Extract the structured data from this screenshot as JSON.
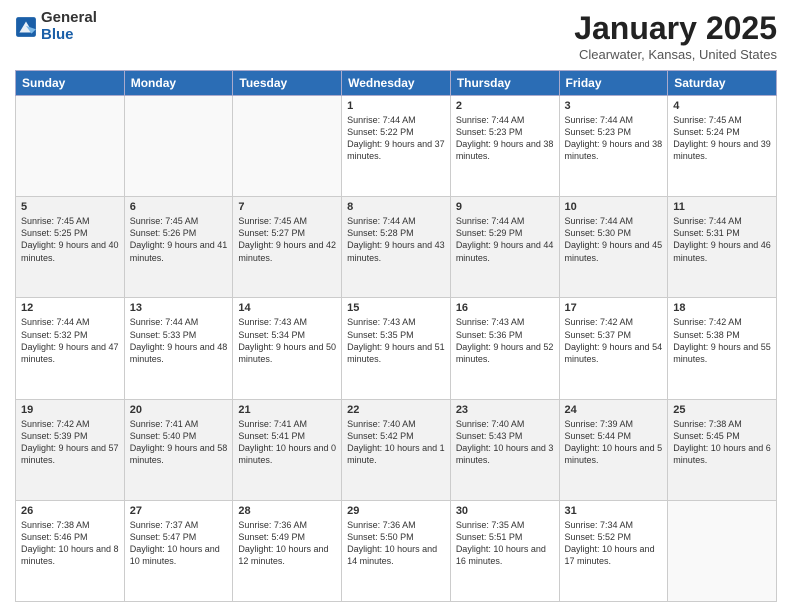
{
  "logo": {
    "general": "General",
    "blue": "Blue"
  },
  "title": "January 2025",
  "location": "Clearwater, Kansas, United States",
  "weekdays": [
    "Sunday",
    "Monday",
    "Tuesday",
    "Wednesday",
    "Thursday",
    "Friday",
    "Saturday"
  ],
  "weeks": [
    [
      {
        "day": "",
        "info": ""
      },
      {
        "day": "",
        "info": ""
      },
      {
        "day": "",
        "info": ""
      },
      {
        "day": "1",
        "info": "Sunrise: 7:44 AM\nSunset: 5:22 PM\nDaylight: 9 hours and 37 minutes."
      },
      {
        "day": "2",
        "info": "Sunrise: 7:44 AM\nSunset: 5:23 PM\nDaylight: 9 hours and 38 minutes."
      },
      {
        "day": "3",
        "info": "Sunrise: 7:44 AM\nSunset: 5:23 PM\nDaylight: 9 hours and 38 minutes."
      },
      {
        "day": "4",
        "info": "Sunrise: 7:45 AM\nSunset: 5:24 PM\nDaylight: 9 hours and 39 minutes."
      }
    ],
    [
      {
        "day": "5",
        "info": "Sunrise: 7:45 AM\nSunset: 5:25 PM\nDaylight: 9 hours and 40 minutes."
      },
      {
        "day": "6",
        "info": "Sunrise: 7:45 AM\nSunset: 5:26 PM\nDaylight: 9 hours and 41 minutes."
      },
      {
        "day": "7",
        "info": "Sunrise: 7:45 AM\nSunset: 5:27 PM\nDaylight: 9 hours and 42 minutes."
      },
      {
        "day": "8",
        "info": "Sunrise: 7:44 AM\nSunset: 5:28 PM\nDaylight: 9 hours and 43 minutes."
      },
      {
        "day": "9",
        "info": "Sunrise: 7:44 AM\nSunset: 5:29 PM\nDaylight: 9 hours and 44 minutes."
      },
      {
        "day": "10",
        "info": "Sunrise: 7:44 AM\nSunset: 5:30 PM\nDaylight: 9 hours and 45 minutes."
      },
      {
        "day": "11",
        "info": "Sunrise: 7:44 AM\nSunset: 5:31 PM\nDaylight: 9 hours and 46 minutes."
      }
    ],
    [
      {
        "day": "12",
        "info": "Sunrise: 7:44 AM\nSunset: 5:32 PM\nDaylight: 9 hours and 47 minutes."
      },
      {
        "day": "13",
        "info": "Sunrise: 7:44 AM\nSunset: 5:33 PM\nDaylight: 9 hours and 48 minutes."
      },
      {
        "day": "14",
        "info": "Sunrise: 7:43 AM\nSunset: 5:34 PM\nDaylight: 9 hours and 50 minutes."
      },
      {
        "day": "15",
        "info": "Sunrise: 7:43 AM\nSunset: 5:35 PM\nDaylight: 9 hours and 51 minutes."
      },
      {
        "day": "16",
        "info": "Sunrise: 7:43 AM\nSunset: 5:36 PM\nDaylight: 9 hours and 52 minutes."
      },
      {
        "day": "17",
        "info": "Sunrise: 7:42 AM\nSunset: 5:37 PM\nDaylight: 9 hours and 54 minutes."
      },
      {
        "day": "18",
        "info": "Sunrise: 7:42 AM\nSunset: 5:38 PM\nDaylight: 9 hours and 55 minutes."
      }
    ],
    [
      {
        "day": "19",
        "info": "Sunrise: 7:42 AM\nSunset: 5:39 PM\nDaylight: 9 hours and 57 minutes."
      },
      {
        "day": "20",
        "info": "Sunrise: 7:41 AM\nSunset: 5:40 PM\nDaylight: 9 hours and 58 minutes."
      },
      {
        "day": "21",
        "info": "Sunrise: 7:41 AM\nSunset: 5:41 PM\nDaylight: 10 hours and 0 minutes."
      },
      {
        "day": "22",
        "info": "Sunrise: 7:40 AM\nSunset: 5:42 PM\nDaylight: 10 hours and 1 minute."
      },
      {
        "day": "23",
        "info": "Sunrise: 7:40 AM\nSunset: 5:43 PM\nDaylight: 10 hours and 3 minutes."
      },
      {
        "day": "24",
        "info": "Sunrise: 7:39 AM\nSunset: 5:44 PM\nDaylight: 10 hours and 5 minutes."
      },
      {
        "day": "25",
        "info": "Sunrise: 7:38 AM\nSunset: 5:45 PM\nDaylight: 10 hours and 6 minutes."
      }
    ],
    [
      {
        "day": "26",
        "info": "Sunrise: 7:38 AM\nSunset: 5:46 PM\nDaylight: 10 hours and 8 minutes."
      },
      {
        "day": "27",
        "info": "Sunrise: 7:37 AM\nSunset: 5:47 PM\nDaylight: 10 hours and 10 minutes."
      },
      {
        "day": "28",
        "info": "Sunrise: 7:36 AM\nSunset: 5:49 PM\nDaylight: 10 hours and 12 minutes."
      },
      {
        "day": "29",
        "info": "Sunrise: 7:36 AM\nSunset: 5:50 PM\nDaylight: 10 hours and 14 minutes."
      },
      {
        "day": "30",
        "info": "Sunrise: 7:35 AM\nSunset: 5:51 PM\nDaylight: 10 hours and 16 minutes."
      },
      {
        "day": "31",
        "info": "Sunrise: 7:34 AM\nSunset: 5:52 PM\nDaylight: 10 hours and 17 minutes."
      },
      {
        "day": "",
        "info": ""
      }
    ]
  ]
}
